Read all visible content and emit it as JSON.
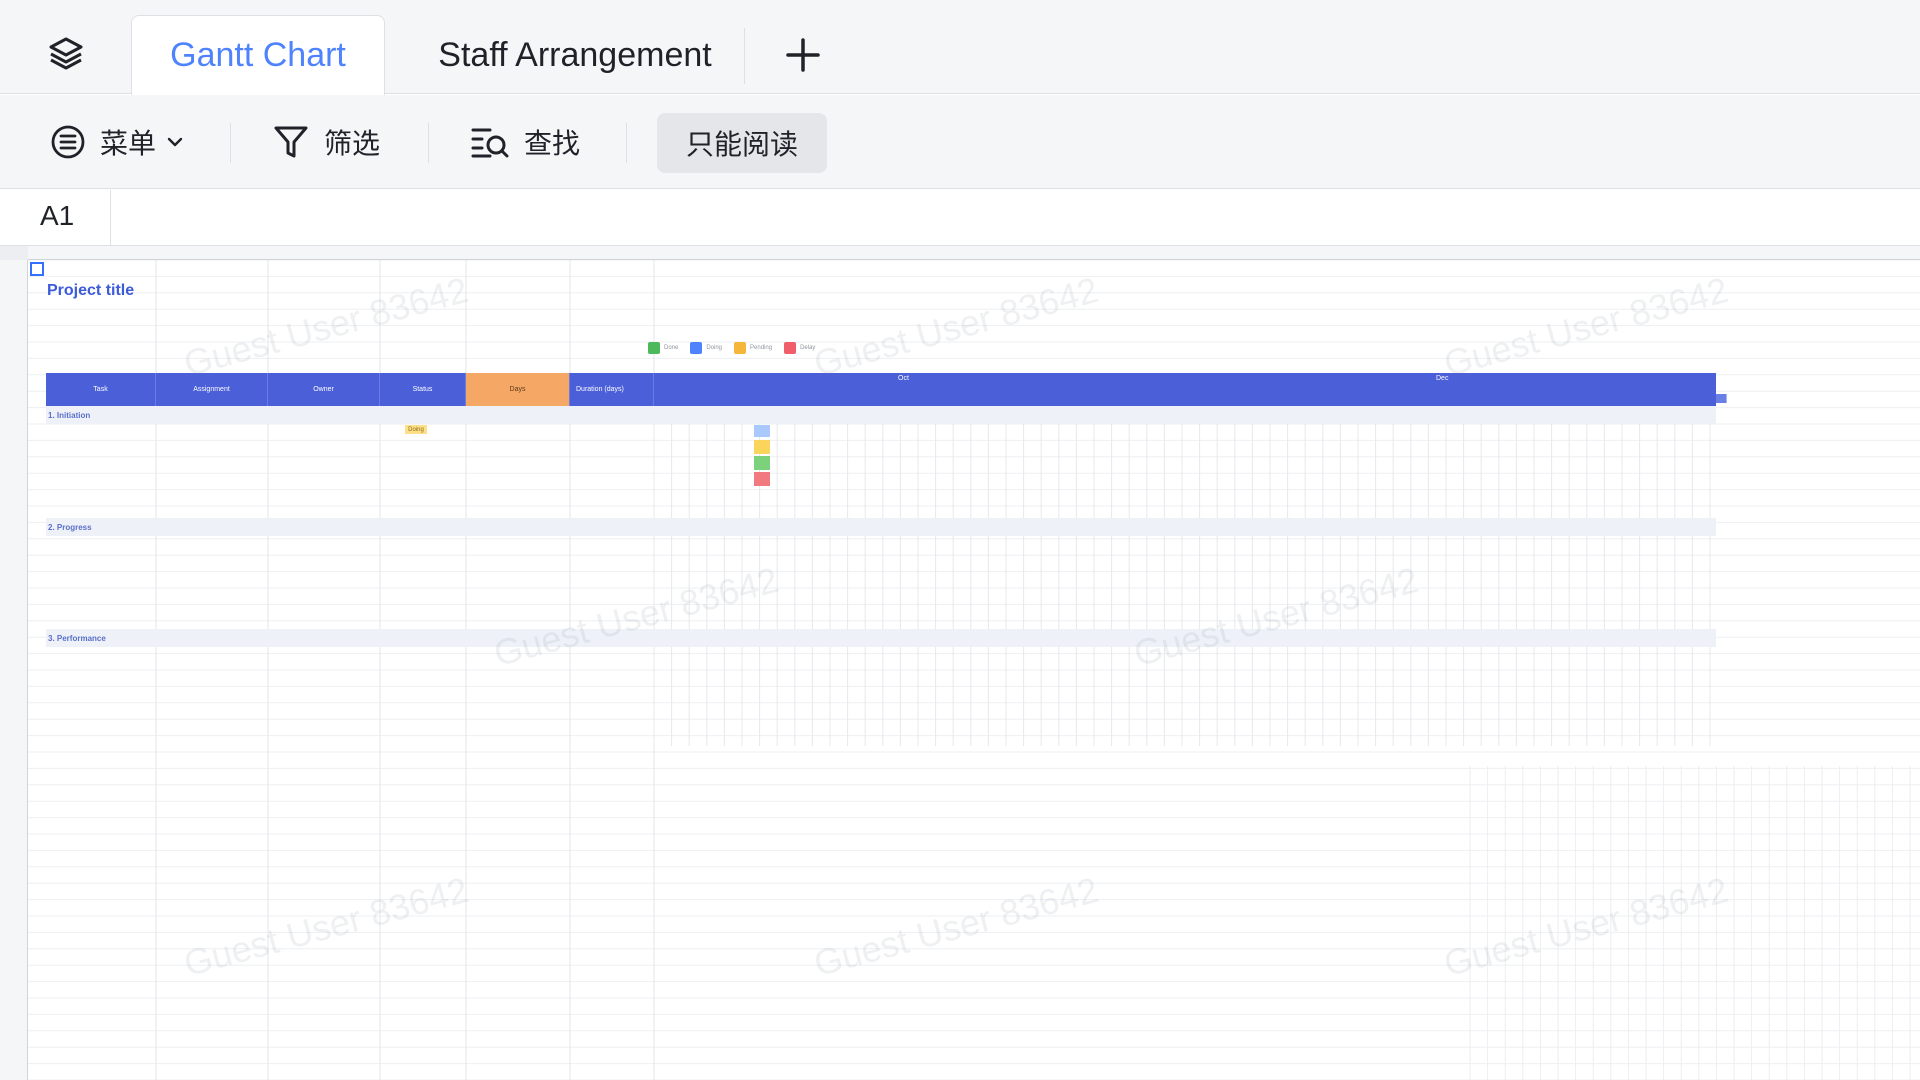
{
  "tabs": [
    {
      "label": "Gantt Chart",
      "active": true
    },
    {
      "label": "Staff Arrangement",
      "active": false
    }
  ],
  "toolbar": {
    "menu_label": "菜单",
    "filter_label": "筛选",
    "find_label": "查找",
    "readonly_label": "只能阅读"
  },
  "formula": {
    "cell_ref": "A1"
  },
  "sheet": {
    "project_title": "Project title",
    "sections": [
      "1. Initiation",
      "2. Progress",
      "3. Performance"
    ],
    "table_headers": [
      "Task",
      "Assignment",
      "Owner",
      "Status",
      "Days",
      "Duration (days)"
    ],
    "months": [
      "Oct",
      "Dec"
    ],
    "legend": [
      {
        "label": "Done",
        "color": "#4cb95c"
      },
      {
        "label": "Doing",
        "color": "#4e83fd"
      },
      {
        "label": "Pending",
        "color": "#f5b73b"
      },
      {
        "label": "Delay",
        "color": "#ef5e6a"
      }
    ],
    "status_sample": "Doing"
  },
  "watermark_text": "Guest User 83642",
  "colors": {
    "accent": "#4e83fd",
    "header_blue": "#4a5fd8",
    "days_orange": "#f5a866",
    "gantt_blue": "#a9c8fb",
    "gantt_yellow": "#fad45b",
    "gantt_green": "#7bd27b",
    "gantt_red": "#f07a80"
  }
}
